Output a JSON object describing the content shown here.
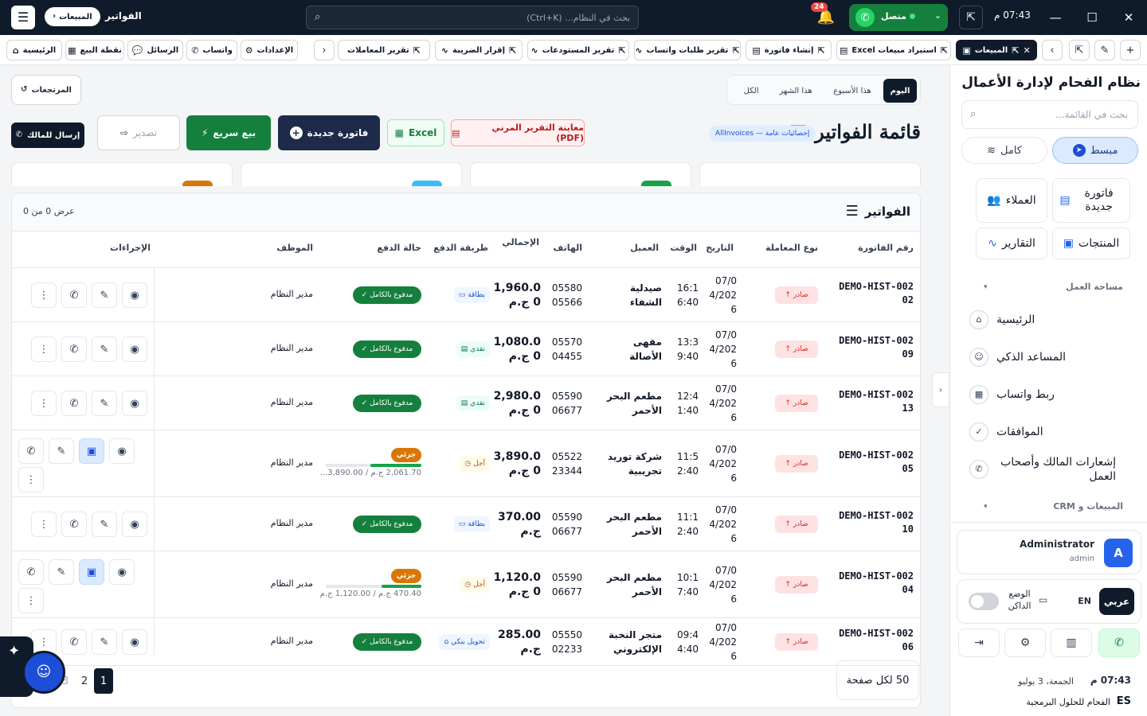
{
  "topbar": {
    "clock": "07:43 م",
    "search_placeholder": "بحث في النظام... (Ctrl+K)",
    "notifications_count": "24",
    "whatsapp_status": "متصل",
    "breadcrumb_current": "الفواتير",
    "breadcrumb_parent": "المبيعات"
  },
  "tabs": [
    {
      "label": "المبيعات",
      "active": true
    },
    {
      "label": "استيراد مبيعات Excel"
    },
    {
      "label": "إنشاء فاتورة"
    },
    {
      "label": "تقرير طلبات واتساب"
    },
    {
      "label": "تقرير المستودعات"
    },
    {
      "label": "إقرار الضريبة"
    },
    {
      "label": "تقرير المعاملات"
    }
  ],
  "quick_tabs": [
    {
      "label": "الإعدادات"
    },
    {
      "label": "واتساب"
    },
    {
      "label": "الرسائل"
    },
    {
      "label": "نقطة البيع"
    },
    {
      "label": "الرئيسية"
    }
  ],
  "sidebar": {
    "title": "نظام الفحام لإدارة الأعمال",
    "search_placeholder": "بحث في القائمة...",
    "mode_simple": "مبسط",
    "mode_full": "كامل",
    "quick": [
      {
        "label": "فاتورة جديدة"
      },
      {
        "label": "العملاء"
      },
      {
        "label": "المنتجات"
      },
      {
        "label": "التقارير"
      }
    ],
    "section_workspace": "مساحة العمل",
    "items": [
      {
        "label": "الرئيسية"
      },
      {
        "label": "المساعد الذكي"
      },
      {
        "label": "ربط واتساب"
      },
      {
        "label": "الموافقات"
      },
      {
        "label": "إشعارات المالك وأصحاب العمل"
      }
    ],
    "section_sales": "المبيعات و CRM",
    "user_name": "Administrator",
    "user_role": "admin",
    "avatar_letter": "A",
    "lang_ar": "عربي",
    "lang_en": "EN",
    "dark_mode": "الوضع الداكن",
    "footer_time": "07:43 م",
    "footer_date": "الجمعة، 3 يوليو",
    "brand": "الفحام للحلول البرمجية"
  },
  "main": {
    "periods": [
      "اليوم",
      "هذا الأسبوع",
      "هذا الشهر",
      "الكل"
    ],
    "returns_label": "المرتجعات",
    "page_title": "قائمة الفواتير",
    "stats_link": "إحصائيات عامة — AllInvoices",
    "btn_pdf": "معاينة التقرير المرني (PDF)",
    "btn_excel": "Excel",
    "btn_new_invoice": "فاتورة جديدة",
    "btn_quick_sale": "بيع سريع",
    "btn_export": "تصدير",
    "btn_send_owner": "إرسال للمالك",
    "table_title": "الفواتير",
    "showing": "عرض 0 من 0",
    "columns": [
      "رقم الفاتورة",
      "نوع المعاملة",
      "التاريخ",
      "الوقت",
      "العميل",
      "الهاتف",
      "الإجمالي",
      "طريقة الدفع",
      "حالة الدفع",
      "الموظف",
      "الإجراءات"
    ],
    "rows": [
      {
        "invoice": "DEMO-HIST-00202",
        "type": "صادر",
        "date": "07/04/2026",
        "time": "16:16:40",
        "customer": "صيدلية الشفاء",
        "phone": "0558005566",
        "total": "1,960.00 ج.م",
        "method": "بطاقة",
        "method_kind": "card",
        "status": "مدفوع بالكامل",
        "employee": "مدير النظام"
      },
      {
        "invoice": "DEMO-HIST-00209",
        "type": "صادر",
        "date": "07/04/2026",
        "time": "13:39:40",
        "customer": "مقهى الأصالة",
        "phone": "0557004455",
        "total": "1,080.00 ج.م",
        "method": "نقدي",
        "method_kind": "cash",
        "status": "مدفوع بالكامل",
        "employee": "مدير النظام"
      },
      {
        "invoice": "DEMO-HIST-00213",
        "type": "صادر",
        "date": "07/04/2026",
        "time": "12:41:40",
        "customer": "مطعم البحر الأحمر",
        "phone": "0559006677",
        "total": "2,980.00 ج.م",
        "method": "نقدي",
        "method_kind": "cash",
        "status": "مدفوع بالكامل",
        "employee": "مدير النظام"
      },
      {
        "invoice": "DEMO-HIST-00205",
        "type": "صادر",
        "date": "07/04/2026",
        "time": "11:52:40",
        "customer": "شركة توريد تجريبية",
        "phone": "0552223344",
        "total": "3,890.00 ج.م",
        "method": "آجل",
        "method_kind": "later",
        "status": "جزئي",
        "partial": "2,061.70 ج.م / 3,890.00...",
        "partial_fraction": 0.53,
        "employee": "مدير النظام"
      },
      {
        "invoice": "DEMO-HIST-00210",
        "type": "صادر",
        "date": "07/04/2026",
        "time": "11:12:40",
        "customer": "مطعم البحر الأحمر",
        "phone": "0559006677",
        "total": "370.00 ج.م",
        "method": "بطاقة",
        "method_kind": "card",
        "status": "مدفوع بالكامل",
        "employee": "مدير النظام"
      },
      {
        "invoice": "DEMO-HIST-00204",
        "type": "صادر",
        "date": "07/04/2026",
        "time": "10:17:40",
        "customer": "مطعم البحر الأحمر",
        "phone": "0559006677",
        "total": "1,120.00 ج.م",
        "method": "آجل",
        "method_kind": "later",
        "status": "جزئي",
        "partial": "470.40 ج.م / 1,120.00 ج.م",
        "partial_fraction": 0.42,
        "employee": "مدير النظام"
      },
      {
        "invoice": "DEMO-HIST-00206",
        "type": "صادر",
        "date": "07/04/2026",
        "time": "09:44:40",
        "customer": "متجر النخبة الإلكتروني",
        "phone": "0555002233",
        "total": "285.00 ج.م",
        "method": "تحويل بنكي",
        "method_kind": "bank",
        "status": "مدفوع بالكامل",
        "employee": "مدير النظام"
      }
    ],
    "pages": [
      "1",
      "2",
      "3"
    ],
    "per_page": "50 لكل صفحة"
  }
}
